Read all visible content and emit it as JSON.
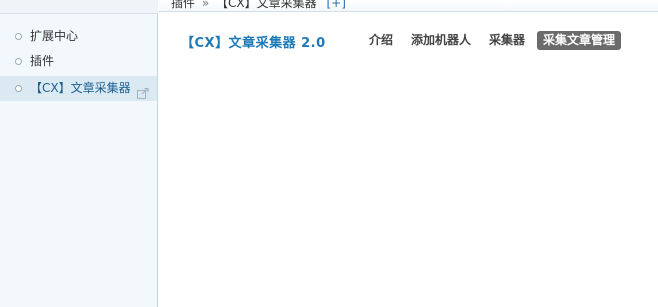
{
  "sidebar": {
    "items": [
      {
        "label": "扩展中心",
        "active": false
      },
      {
        "label": "插件",
        "active": false
      },
      {
        "label": "【CX】文章采集器",
        "active": true,
        "icon": "external-link-icon"
      }
    ]
  },
  "breadcrumb": {
    "parent": "插件",
    "separator": "»",
    "current": "【CX】文章采集器",
    "add_label": "[+]"
  },
  "plugin": {
    "title": "【CX】文章采集器 2.0"
  },
  "tabs": [
    {
      "label": "介绍",
      "active": false
    },
    {
      "label": "添加机器人",
      "active": false
    },
    {
      "label": "采集器",
      "active": false
    },
    {
      "label": "采集文章管理",
      "active": true
    }
  ],
  "colors": {
    "accent": "#1d7ab7",
    "active_tab_bg": "#6b6b6b",
    "sidebar_bg": "#f2f8fc",
    "sidebar_active_bg": "#dbe9f3"
  }
}
